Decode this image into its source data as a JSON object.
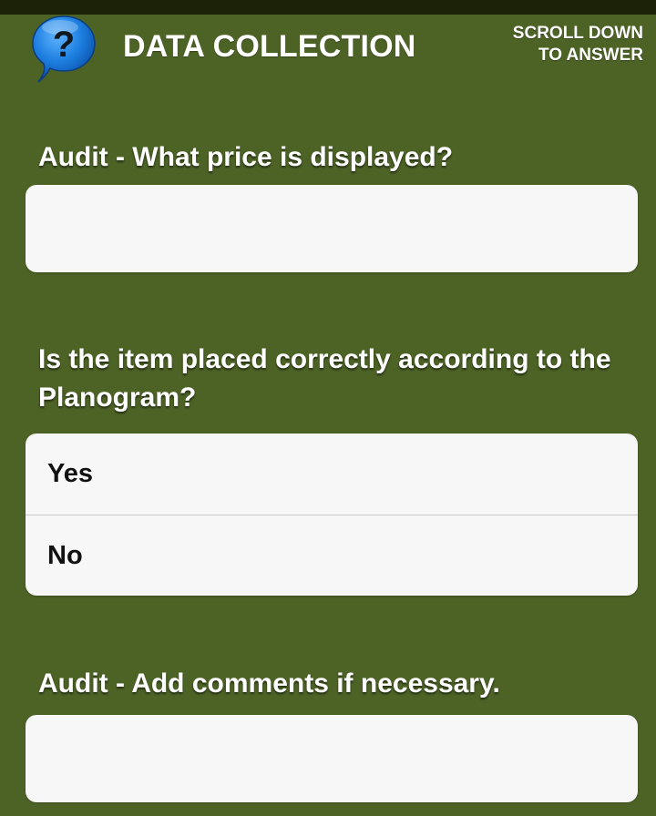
{
  "header": {
    "title": "DATA COLLECTION",
    "scroll_hint_line1": "SCROLL DOWN",
    "scroll_hint_line2": "TO ANSWER",
    "help_icon": "question-bubble-icon",
    "help_glyph": "?"
  },
  "questions": [
    {
      "label": "Audit - What price is displayed?",
      "type": "text",
      "value": ""
    },
    {
      "label": "Is the item placed correctly according to the Planogram?",
      "type": "choice",
      "options": [
        "Yes",
        "No"
      ]
    },
    {
      "label": "Audit - Add comments if necessary.",
      "type": "text",
      "value": ""
    }
  ],
  "colors": {
    "background": "#4d6326",
    "top_strip": "#1b2208",
    "field_background": "#f7f7f7",
    "help_icon_blue": "#1d7fe0"
  }
}
